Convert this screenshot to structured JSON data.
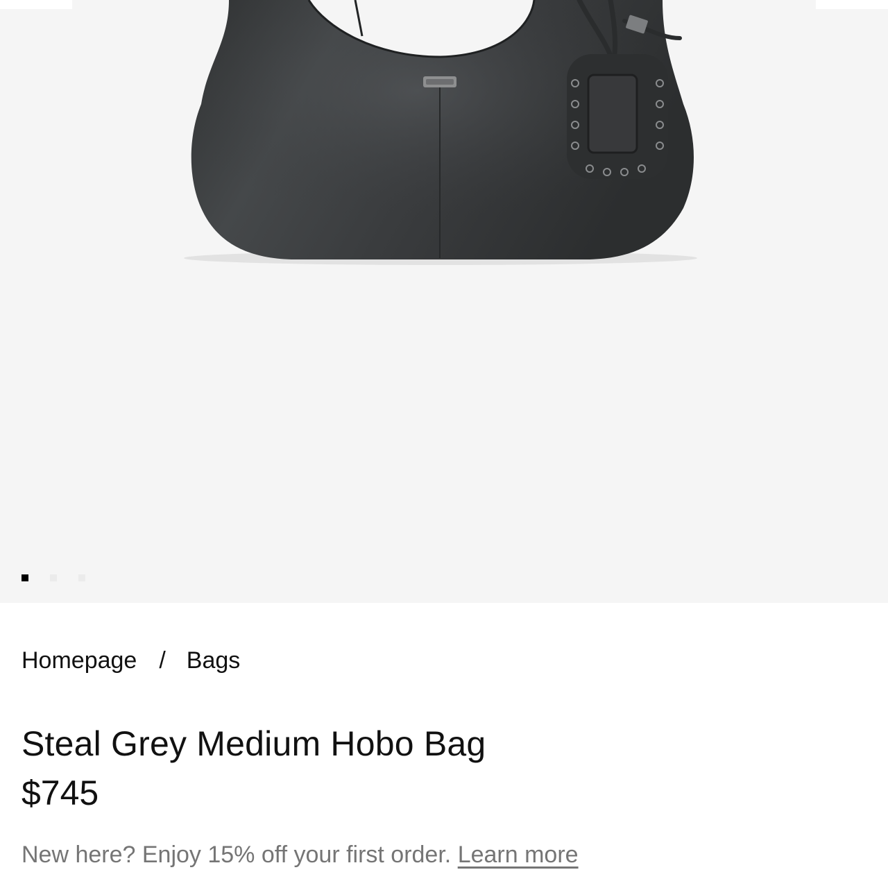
{
  "gallery": {
    "image_subject": "Steal Grey Medium Hobo Bag product photo",
    "slides_total": 3,
    "active_slide": 1
  },
  "breadcrumb": {
    "home": "Homepage",
    "separator": "/",
    "category": "Bags"
  },
  "product": {
    "title": "Steal Grey Medium Hobo Bag",
    "price": "$745"
  },
  "promo": {
    "text": "New here? Enjoy 15% off your first order.",
    "link": "Learn more"
  },
  "colors": {
    "background": "#ffffff",
    "gallery_background": "#f5f5f5",
    "text": "#111111",
    "muted_text": "#757575",
    "bag": "#3b3d3e"
  }
}
